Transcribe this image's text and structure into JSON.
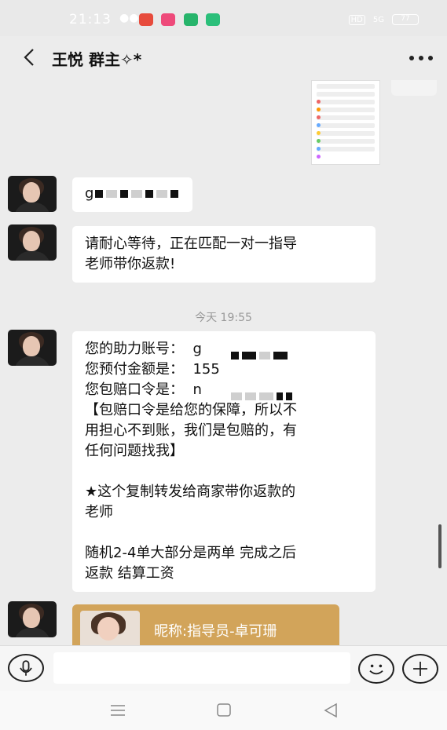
{
  "status_bar": {
    "time": "21:13",
    "hd": "HD",
    "network": "5G",
    "battery": "77"
  },
  "header": {
    "title": "王悦  群主✧*"
  },
  "messages": {
    "msg1_text": "g",
    "msg2_text": "请耐心等待，正在匹配一对一指导\n老师带你返款!",
    "time_separator": "今天 19:55",
    "msg3_text": "您的助力账号：  g\n您预付金额是：  155\n您包赔口令是：  n\n【包赔口令是给您的保障，所以不\n用担心不到账，我们是包赔的，有\n任何问题找我】\n\n★这个复制转发给商家带你返款的\n老师\n\n随机2-4单大部分是两单 完成之后\n返款 结算工资",
    "card_title": "昵称:指导员-卓可珊"
  },
  "input": {
    "placeholder": ""
  }
}
